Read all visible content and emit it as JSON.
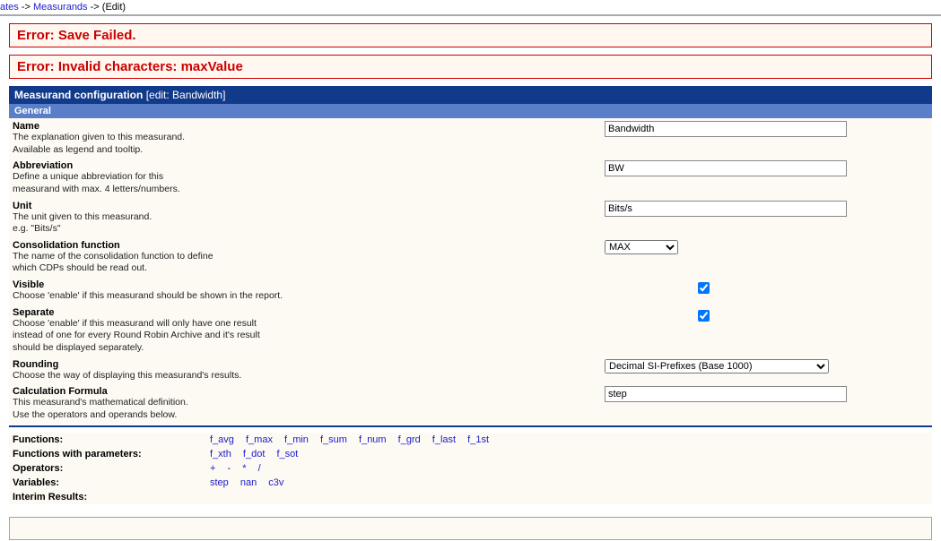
{
  "breadcrumb": {
    "part1": "ates",
    "sep": " -> ",
    "part2": "Measurands",
    "part3": "(Edit)"
  },
  "errors": [
    "Error: Save Failed.",
    "Error: Invalid characters: maxValue"
  ],
  "panel": {
    "title": "Measurand configuration",
    "context": "[edit: Bandwidth]"
  },
  "sections": {
    "general": "General"
  },
  "form": {
    "name": {
      "label": "Name",
      "desc1": "The explanation given to this measurand.",
      "desc2": "Available as legend and tooltip.",
      "value": "Bandwidth"
    },
    "abbr": {
      "label": "Abbreviation",
      "desc1": "Define a unique abbreviation for this",
      "desc2": "measurand with max. 4 letters/numbers.",
      "value": "BW"
    },
    "unit": {
      "label": "Unit",
      "desc1": "The unit given to this measurand.",
      "desc2": "e.g. \"Bits/s\"",
      "value": "Bits/s"
    },
    "consol": {
      "label": "Consolidation function",
      "desc1": "The name of the consolidation function to define",
      "desc2": "which CDPs should be read out.",
      "value": "MAX"
    },
    "visible": {
      "label": "Visible",
      "desc1": "Choose 'enable' if this measurand should be shown in the report."
    },
    "separate": {
      "label": "Separate",
      "desc1": "Choose 'enable' if this measurand will only have one result",
      "desc2": "instead of one for every Round Robin Archive and it's result",
      "desc3": "should be displayed separately."
    },
    "rounding": {
      "label": "Rounding",
      "desc1": "Choose the way of displaying this measurand's results.",
      "value": "Decimal SI-Prefixes (Base 1000)"
    },
    "formula": {
      "label": "Calculation Formula",
      "desc1": "This measurand's mathematical definition.",
      "desc2": "Use the operators and operands below.",
      "value": "step"
    }
  },
  "ref": {
    "functions": {
      "label": "Functions:",
      "items": [
        "f_avg",
        "f_max",
        "f_min",
        "f_sum",
        "f_num",
        "f_grd",
        "f_last",
        "f_1st"
      ]
    },
    "functions_params": {
      "label": "Functions with parameters:",
      "items": [
        "f_xth",
        "f_dot",
        "f_sot"
      ]
    },
    "operators": {
      "label": "Operators:",
      "items": [
        "+",
        "-",
        "*",
        "/"
      ]
    },
    "variables": {
      "label": "Variables:",
      "items": [
        "step",
        "nan",
        "c3v"
      ]
    },
    "interim": {
      "label": "Interim Results:"
    }
  }
}
